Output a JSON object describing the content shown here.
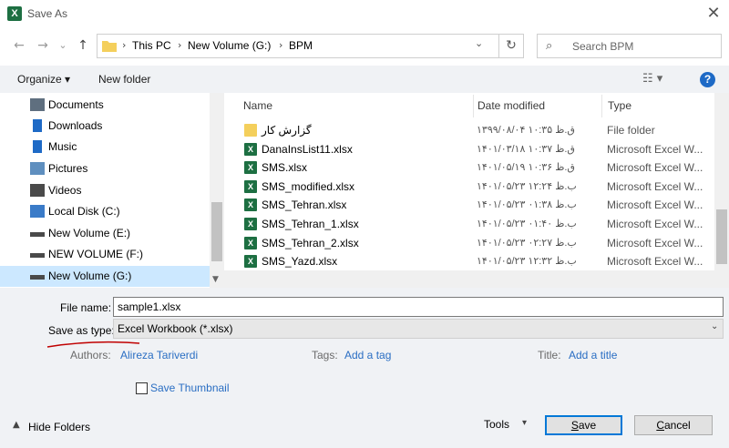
{
  "window": {
    "title": "Save As",
    "app_icon": "excel-icon",
    "close_glyph": "✕"
  },
  "nav": {
    "back_glyph": "←",
    "forward_glyph": "→",
    "history_glyph": "⌄",
    "up_glyph": "↑",
    "breadcrumb": [
      "This PC",
      "New Volume (G:)",
      "BPM"
    ],
    "search_placeholder": "Search BPM"
  },
  "toolbar": {
    "organize": "Organize ▾",
    "new_folder": "New folder",
    "view_glyph": "☷ ▾",
    "help_glyph": "?"
  },
  "sidebar": {
    "items": [
      {
        "label": "Documents",
        "icon": "documents-icon",
        "color": "#5f6f7f"
      },
      {
        "label": "Downloads",
        "icon": "downloads-icon",
        "color": "#1e6ac6"
      },
      {
        "label": "Music",
        "icon": "music-icon",
        "color": "#1e6ac6"
      },
      {
        "label": "Pictures",
        "icon": "pictures-icon",
        "color": "#5f8fbf"
      },
      {
        "label": "Videos",
        "icon": "videos-icon",
        "color": "#4a4a4a"
      },
      {
        "label": "Local Disk (C:)",
        "icon": "disk-icon",
        "color": "#3a7bc8"
      },
      {
        "label": "New Volume (E:)",
        "icon": "drive-icon",
        "color": "#4a4a4a"
      },
      {
        "label": "NEW VOLUME (F:)",
        "icon": "drive-icon",
        "color": "#4a4a4a"
      },
      {
        "label": "New Volume (G:)",
        "icon": "drive-icon",
        "color": "#4a4a4a",
        "selected": true
      }
    ]
  },
  "files": {
    "columns": {
      "name": "Name",
      "date": "Date modified",
      "type": "Type"
    },
    "rows": [
      {
        "name": "گزارش کار",
        "date": "۱۳۹۹/۰۸/۰۴ ق.ظ ۱۰:۳۵",
        "type": "File folder",
        "kind": "folder"
      },
      {
        "name": "DanaInsList11.xlsx",
        "date": "۱۴۰۱/۰۳/۱۸ ق.ظ ۱۰:۳۷",
        "type": "Microsoft Excel W...",
        "kind": "excel"
      },
      {
        "name": "SMS.xlsx",
        "date": "۱۴۰۱/۰۵/۱۹ ق.ظ ۱۰:۳۶",
        "type": "Microsoft Excel W...",
        "kind": "excel"
      },
      {
        "name": "SMS_modified.xlsx",
        "date": "۱۴۰۱/۰۵/۲۳ ب.ظ ۱۲:۲۴",
        "type": "Microsoft Excel W...",
        "kind": "excel"
      },
      {
        "name": "SMS_Tehran.xlsx",
        "date": "۱۴۰۱/۰۵/۲۳ ب.ظ ۰۱:۳۸",
        "type": "Microsoft Excel W...",
        "kind": "excel"
      },
      {
        "name": "SMS_Tehran_1.xlsx",
        "date": "۱۴۰۱/۰۵/۲۳ ب.ظ ۰۱:۴۰",
        "type": "Microsoft Excel W...",
        "kind": "excel"
      },
      {
        "name": "SMS_Tehran_2.xlsx",
        "date": "۱۴۰۱/۰۵/۲۳ ب.ظ ۰۲:۲۷",
        "type": "Microsoft Excel W...",
        "kind": "excel"
      },
      {
        "name": "SMS_Yazd.xlsx",
        "date": "۱۴۰۱/۰۵/۲۳ ب.ظ ۱۲:۳۲",
        "type": "Microsoft Excel W...",
        "kind": "excel"
      }
    ]
  },
  "form": {
    "file_name_label": "File name:",
    "file_name_value": "sample1.xlsx",
    "save_as_type_label": "Save as type:",
    "save_as_type_value": "Excel Workbook (*.xlsx)",
    "authors_label": "Authors:",
    "authors_value": "Alireza Tariverdi",
    "tags_label": "Tags:",
    "tags_value": "Add a tag",
    "title_label": "Title:",
    "title_value": "Add a title",
    "save_thumbnail_label": "Save Thumbnail"
  },
  "footer": {
    "hide_folders": "Hide Folders",
    "tools": "Tools",
    "save": "Save",
    "cancel": "Cancel"
  },
  "colors": {
    "accent": "#0078d7",
    "link": "#2a6ec3",
    "selection": "#cce8ff",
    "excel": "#1d6f42",
    "annotation": "#c00000"
  }
}
